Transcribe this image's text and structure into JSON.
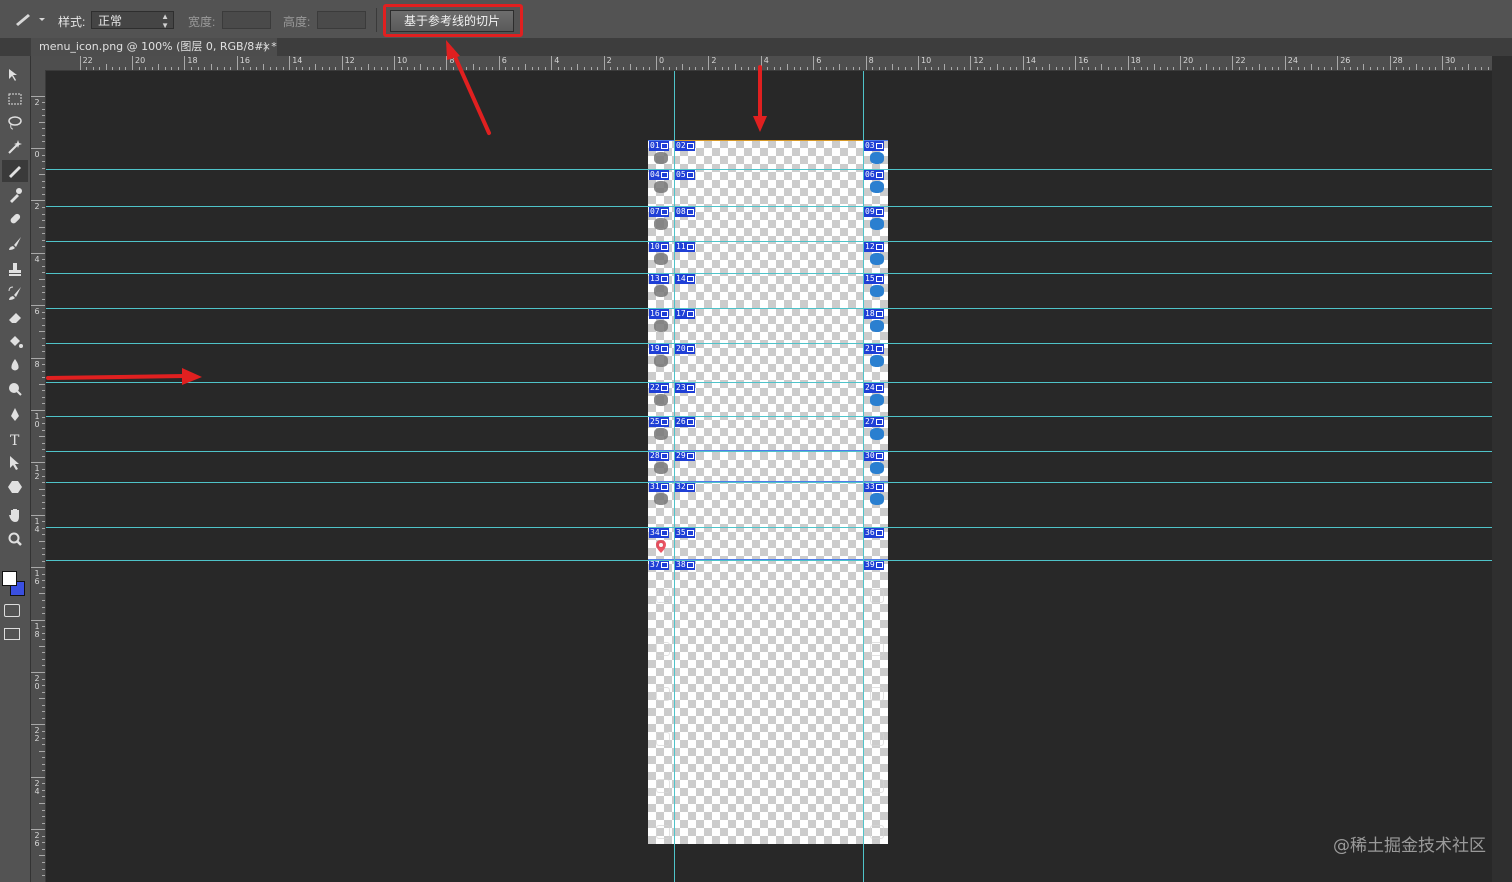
{
  "options_bar": {
    "style_label": "样式:",
    "style_value": "正常",
    "width_label": "宽度:",
    "height_label": "高度:",
    "slices_from_guides_button": "基于参考线的切片"
  },
  "document_tab": {
    "title": "menu_icon.png @ 100% (图层 0, RGB/8#) *",
    "close": "×"
  },
  "ruler_top_labels": [
    "22",
    "20",
    "18",
    "16",
    "14",
    "12",
    "10",
    "8",
    "6",
    "4",
    "2",
    "0",
    "2",
    "4",
    "6",
    "8",
    "10",
    "12",
    "14",
    "16",
    "18",
    "20",
    "22",
    "24",
    "26",
    "28",
    "30"
  ],
  "ruler_left_labels": [
    "2",
    "0",
    "2",
    "4",
    "6",
    "8",
    "10",
    "12",
    "14",
    "16",
    "18",
    "20",
    "22",
    "24",
    "26"
  ],
  "slices": [
    "01",
    "02",
    "03",
    "04",
    "05",
    "06",
    "07",
    "08",
    "09",
    "10",
    "11",
    "12",
    "13",
    "14",
    "15",
    "16",
    "17",
    "18",
    "19",
    "20",
    "21",
    "22",
    "23",
    "24",
    "25",
    "26",
    "27",
    "28",
    "29",
    "30",
    "31",
    "32",
    "33",
    "34",
    "35",
    "36",
    "37",
    "38",
    "39"
  ],
  "colors": {
    "guide": "#4fc3c9",
    "slice_badge": "#1f3fd6",
    "highlight": "#e02020",
    "icon_blue": "#2a7fd0",
    "icon_grey": "#777777",
    "marker_red": "#e8394a"
  },
  "icons": {
    "tool_preset": "pen-slice-icon",
    "toolbox": [
      "move-icon",
      "marquee-icon",
      "lasso-icon",
      "magic-wand-icon",
      "slice-icon",
      "eyedropper-icon",
      "healing-brush-icon",
      "brush-icon",
      "clone-stamp-icon",
      "history-brush-icon",
      "eraser-icon",
      "paint-bucket-icon",
      "blur-icon",
      "dodge-icon",
      "pen-icon",
      "type-icon",
      "path-select-icon",
      "shape-icon",
      "hand-icon",
      "zoom-icon"
    ]
  },
  "toolbox_type_glyph": "T",
  "watermark": "@稀土掘金技术社区"
}
